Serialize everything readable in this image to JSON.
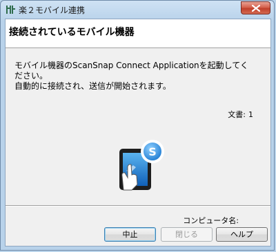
{
  "window": {
    "title": "楽２モバイル連携",
    "icons": {
      "app": "scansnap-app-icon",
      "close": "close-icon"
    }
  },
  "header": {
    "title": "接続されているモバイル機器"
  },
  "instructions": {
    "line1": "モバイル機器のScanSnap Connect Applicationを起動してく",
    "line2": "ださい。",
    "line3": "自動的に接続され、送信が開始されます。"
  },
  "status": {
    "documents_label": "文書:",
    "documents_count": "1"
  },
  "illustration": {
    "icon": "tablet-hand-touch-icon",
    "badge_letter": "S"
  },
  "footer": {
    "computer_name_label": "コンピュータ名:",
    "buttons": {
      "cancel": "中止",
      "close": "閉じる",
      "help": "ヘルプ"
    }
  },
  "colors": {
    "accent": "#2a86d6",
    "badge": "#3aa0e8"
  }
}
